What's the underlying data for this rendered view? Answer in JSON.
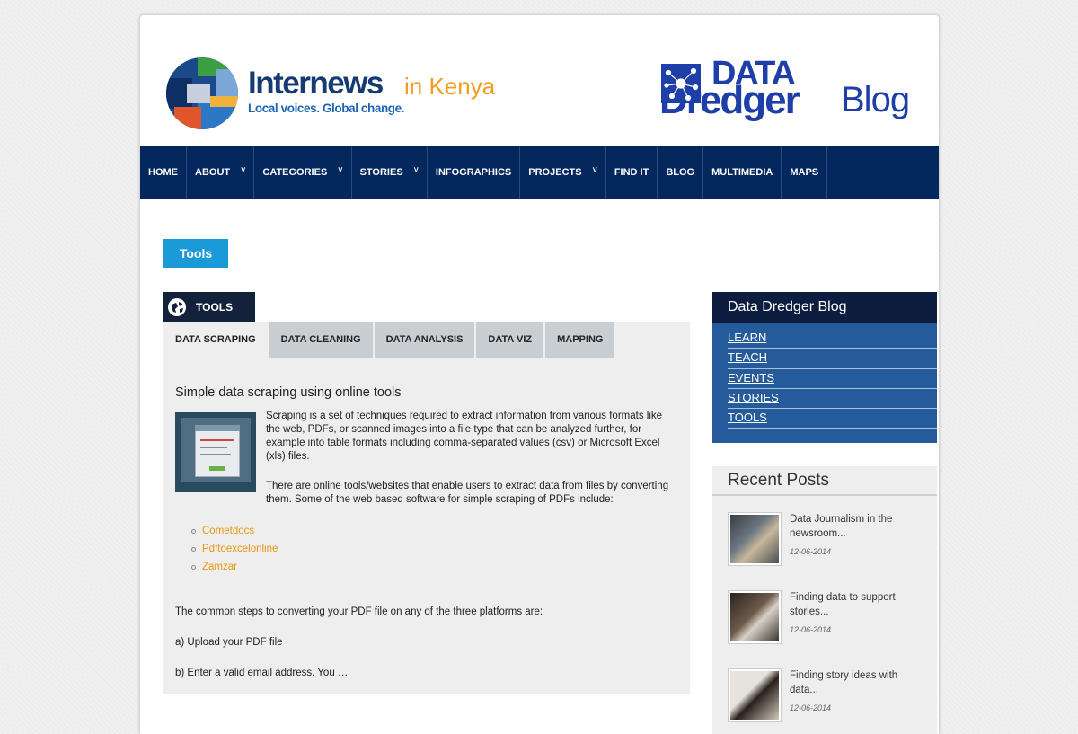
{
  "header": {
    "brand_name": "Internews",
    "brand_location": "in Kenya",
    "brand_tagline": "Local voices. Global change.",
    "blog_logo_word1": "DATA",
    "blog_logo_word2": "Dredger",
    "blog_logo_word3": "Blog"
  },
  "nav": {
    "items": [
      {
        "label": "HOME",
        "dropdown": false
      },
      {
        "label": "ABOUT",
        "dropdown": true
      },
      {
        "label": "CATEGORIES",
        "dropdown": true
      },
      {
        "label": "STORIES",
        "dropdown": true
      },
      {
        "label": "INFOGRAPHICS",
        "dropdown": false
      },
      {
        "label": "PROJECTS",
        "dropdown": true
      },
      {
        "label": "FIND IT",
        "dropdown": false
      },
      {
        "label": "BLOG",
        "dropdown": false
      },
      {
        "label": "MULTIMEDIA",
        "dropdown": false
      },
      {
        "label": "MAPS",
        "dropdown": false
      }
    ]
  },
  "page_label": "Tools",
  "panel": {
    "title": "TOOLS",
    "tabs": [
      "DATA SCRAPING",
      "DATA CLEANING",
      "DATA ANALYSIS",
      "DATA VIZ",
      "MAPPING"
    ],
    "active_tab": "DATA SCRAPING"
  },
  "article": {
    "title": "Simple data scraping using online tools",
    "p1_lines": [
      "Scraping is a set of techniques required to extract information from various formats like",
      "the web, PDFs, or scanned images into a file type that can be analyzed further, for",
      "example into table formats including comma-separated values (csv) or Microsoft Excel",
      "(xls) files."
    ],
    "p2_lines": [
      "There are online tools/websites that enable users to extract data from files by converting",
      "them. Some of the web based software for simple scraping of PDFs include:"
    ],
    "links": [
      "Cometdocs",
      "Pdftoexcelonline",
      "Zamzar"
    ],
    "p3": "The common steps to converting your PDF file on any of the three platforms are:",
    "p4": "a) Upload your PDF file",
    "p5": "b) Enter a valid email address. You …"
  },
  "sidebar": {
    "blog_title": "Data Dredger Blog",
    "blog_links": [
      "LEARN",
      "TEACH",
      "EVENTS",
      "STORIES",
      "TOOLS"
    ],
    "recent_title": "Recent Posts",
    "posts": [
      {
        "title_l1": "Data Journalism in the",
        "title_l2": "newsroom...",
        "date": "12-06-2014"
      },
      {
        "title_l1": "Finding data to support",
        "title_l2": "stories...",
        "date": "12-06-2014"
      },
      {
        "title_l1": "Finding story ideas with",
        "title_l2": "data...",
        "date": "12-06-2014"
      }
    ]
  },
  "colors": {
    "nav_bg": "#04275d",
    "accent_blue": "#1a9ad6",
    "link_orange": "#e8960c",
    "sidebar_blue": "#255b9b"
  }
}
